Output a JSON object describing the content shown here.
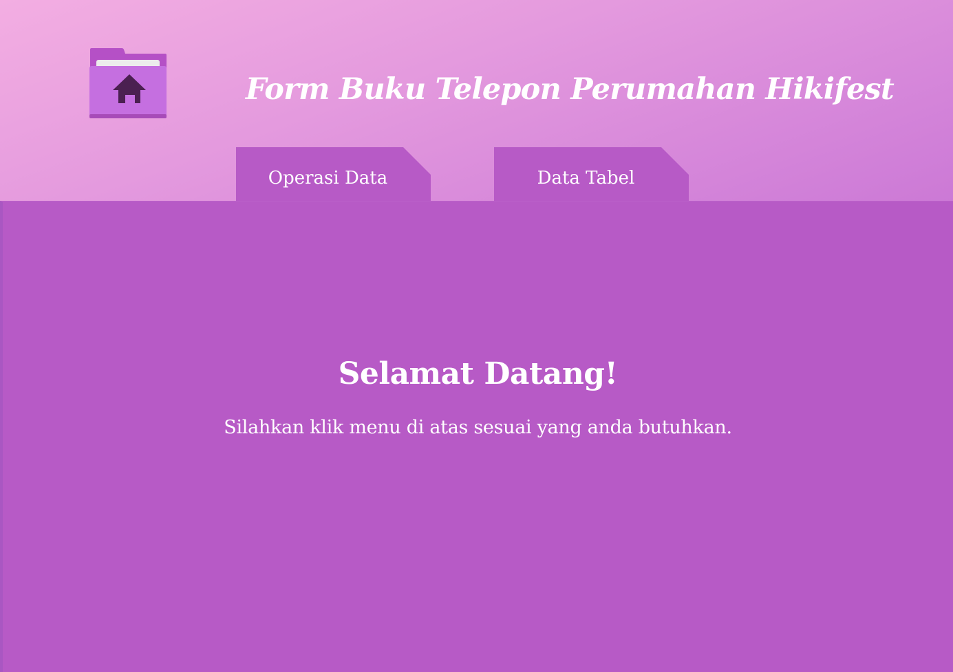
{
  "header": {
    "logo_icon": "folder-home-icon",
    "title": "Form Buku Telepon Perumahan Hikifest"
  },
  "tabs": [
    {
      "label": "Operasi Data"
    },
    {
      "label": "Data Tabel"
    }
  ],
  "main": {
    "heading": "Selamat Datang!",
    "message": "Silahkan klik menu di atas sesuai yang anda butuhkan."
  },
  "colors": {
    "background_gradient_start": "#f3aee2",
    "background_gradient_end": "#b458c5",
    "panel": "#b75ac6",
    "folder_front": "#c56fe0",
    "folder_back": "#b550c6",
    "house_icon": "#4b2051",
    "text": "#ffffff"
  }
}
